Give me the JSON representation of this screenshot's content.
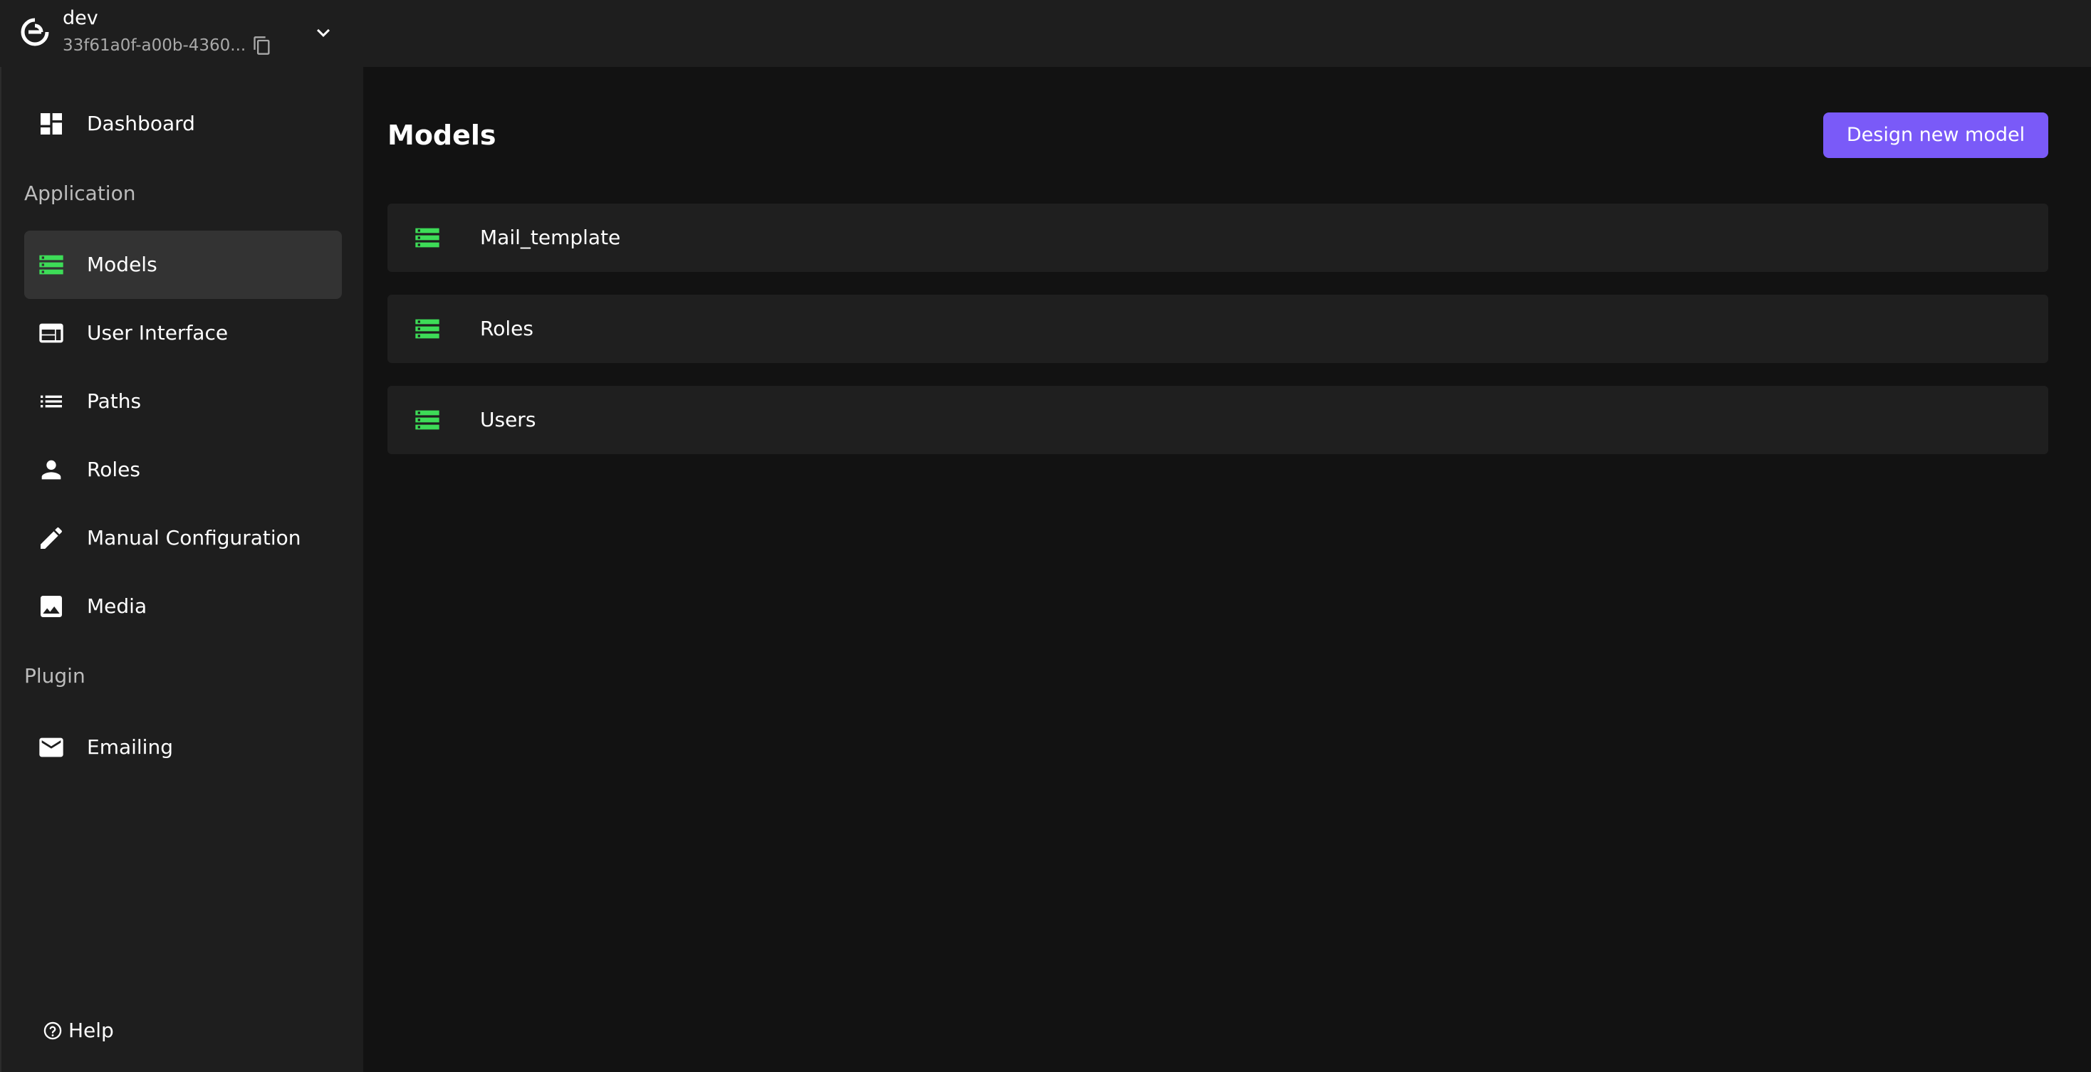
{
  "project": {
    "name": "dev",
    "id": "33f61a0f-a00b-4360...",
    "logo_icon": "logo-icon",
    "copy_icon": "copy-icon",
    "switch_icon": "chevron-down-icon"
  },
  "sidebar": {
    "top_item": {
      "label": "Dashboard",
      "icon": "dashboard-icon"
    },
    "application_heading": "Application",
    "application_items": [
      {
        "label": "Models",
        "icon": "storage-icon",
        "active": true
      },
      {
        "label": "User Interface",
        "icon": "layout-icon"
      },
      {
        "label": "Paths",
        "icon": "list-icon"
      },
      {
        "label": "Roles",
        "icon": "person-icon"
      },
      {
        "label": "Manual Configuration",
        "icon": "pencil-icon"
      },
      {
        "label": "Media",
        "icon": "image-icon"
      }
    ],
    "plugin_heading": "Plugin",
    "plugin_items": [
      {
        "label": "Emailing",
        "icon": "mail-icon"
      }
    ],
    "help_label": "Help"
  },
  "main": {
    "title": "Models",
    "new_button_label": "Design new model",
    "models": [
      {
        "label": "Mail_template",
        "icon": "storage-icon"
      },
      {
        "label": "Roles",
        "icon": "storage-icon"
      },
      {
        "label": "Users",
        "icon": "storage-icon"
      }
    ]
  },
  "colors": {
    "accent": "#7a5af8",
    "model_icon": "#3ddc57",
    "sidebar_bg": "#1e1e1e",
    "main_bg": "#121212",
    "active_item_bg": "#333333"
  }
}
